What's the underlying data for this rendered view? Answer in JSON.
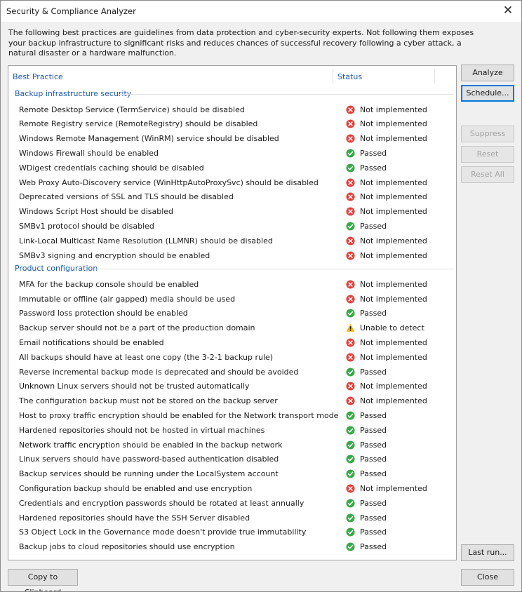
{
  "window": {
    "title": "Security & Compliance Analyzer",
    "close_glyph": "✕"
  },
  "description": "The following best practices are guidelines from data protection and cyber-security experts. Not following them exposes your backup infrastructure to significant risks and reduces chances of successful recovery following a cyber attack, a natural disaster or a hardware malfunction.",
  "columns": {
    "best_practice": "Best Practice",
    "status": "Status"
  },
  "colors": {
    "accent": "#1e5aa8",
    "not_implemented": "#e0413c",
    "passed": "#3aa84a",
    "warning": "#f4b400"
  },
  "status_icons": {
    "fail": "error-circle-x-icon",
    "pass": "check-circle-icon",
    "warn": "warning-triangle-icon"
  },
  "groups": [
    {
      "title": "Backup infrastructure security",
      "items": [
        {
          "label": "Remote Desktop Service (TermService) should be disabled",
          "status": "Not implemented",
          "kind": "fail"
        },
        {
          "label": "Remote Registry service (RemoteRegistry) should be disabled",
          "status": "Not implemented",
          "kind": "fail"
        },
        {
          "label": "Windows Remote Management (WinRM) service should be disabled",
          "status": "Not implemented",
          "kind": "fail"
        },
        {
          "label": "Windows Firewall should be enabled",
          "status": "Passed",
          "kind": "pass"
        },
        {
          "label": "WDigest credentials caching should be disabled",
          "status": "Passed",
          "kind": "pass"
        },
        {
          "label": "Web Proxy Auto-Discovery service (WinHttpAutoProxySvc) should be disabled",
          "status": "Not implemented",
          "kind": "fail"
        },
        {
          "label": "Deprecated versions of SSL and TLS should be disabled",
          "status": "Not implemented",
          "kind": "fail"
        },
        {
          "label": "Windows Script Host should be disabled",
          "status": "Not implemented",
          "kind": "fail"
        },
        {
          "label": "SMBv1 protocol should be disabled",
          "status": "Passed",
          "kind": "pass"
        },
        {
          "label": "Link-Local Multicast Name Resolution (LLMNR) should be disabled",
          "status": "Not implemented",
          "kind": "fail"
        },
        {
          "label": "SMBv3 signing and encryption should be enabled",
          "status": "Not implemented",
          "kind": "fail"
        }
      ]
    },
    {
      "title": "Product configuration",
      "items": [
        {
          "label": "MFA for the backup console should be enabled",
          "status": "Not implemented",
          "kind": "fail"
        },
        {
          "label": "Immutable or offline (air gapped) media should be used",
          "status": "Not implemented",
          "kind": "fail"
        },
        {
          "label": "Password loss protection should be enabled",
          "status": "Passed",
          "kind": "pass"
        },
        {
          "label": "Backup server should not be a part of the production domain",
          "status": "Unable to detect",
          "kind": "warn"
        },
        {
          "label": "Email notifications should be enabled",
          "status": "Not implemented",
          "kind": "fail"
        },
        {
          "label": "All backups should have at least one copy (the 3-2-1 backup rule)",
          "status": "Not implemented",
          "kind": "fail"
        },
        {
          "label": "Reverse incremental backup mode is deprecated and should be avoided",
          "status": "Passed",
          "kind": "pass"
        },
        {
          "label": "Unknown Linux servers should not be trusted automatically",
          "status": "Not implemented",
          "kind": "fail"
        },
        {
          "label": "The configuration backup must not be stored on the backup server",
          "status": "Not implemented",
          "kind": "fail"
        },
        {
          "label": "Host to proxy traffic encryption should be enabled for the Network transport mode",
          "status": "Passed",
          "kind": "pass"
        },
        {
          "label": "Hardened repositories should not be hosted in virtual machines",
          "status": "Passed",
          "kind": "pass"
        },
        {
          "label": "Network traffic encryption should be enabled in the backup network",
          "status": "Passed",
          "kind": "pass"
        },
        {
          "label": "Linux servers should have password-based authentication disabled",
          "status": "Passed",
          "kind": "pass"
        },
        {
          "label": "Backup services should be running under the LocalSystem account",
          "status": "Passed",
          "kind": "pass"
        },
        {
          "label": "Configuration backup should be enabled and use encryption",
          "status": "Not implemented",
          "kind": "fail"
        },
        {
          "label": "Credentials and encryption passwords should be rotated at least annually",
          "status": "Passed",
          "kind": "pass"
        },
        {
          "label": "Hardened repositories should have the SSH Server disabled",
          "status": "Passed",
          "kind": "pass"
        },
        {
          "label": "S3 Object Lock in the Governance mode doesn't provide true immutability",
          "status": "Passed",
          "kind": "pass"
        },
        {
          "label": "Backup jobs to cloud repositories should use encryption",
          "status": "Passed",
          "kind": "pass"
        }
      ]
    }
  ],
  "buttons": {
    "analyze": "Analyze",
    "schedule": "Schedule...",
    "suppress": "Suppress",
    "reset": "Reset",
    "reset_all": "Reset All",
    "last_run": "Last run...",
    "copy_clipboard": "Copy to Clipboard",
    "close": "Close"
  }
}
